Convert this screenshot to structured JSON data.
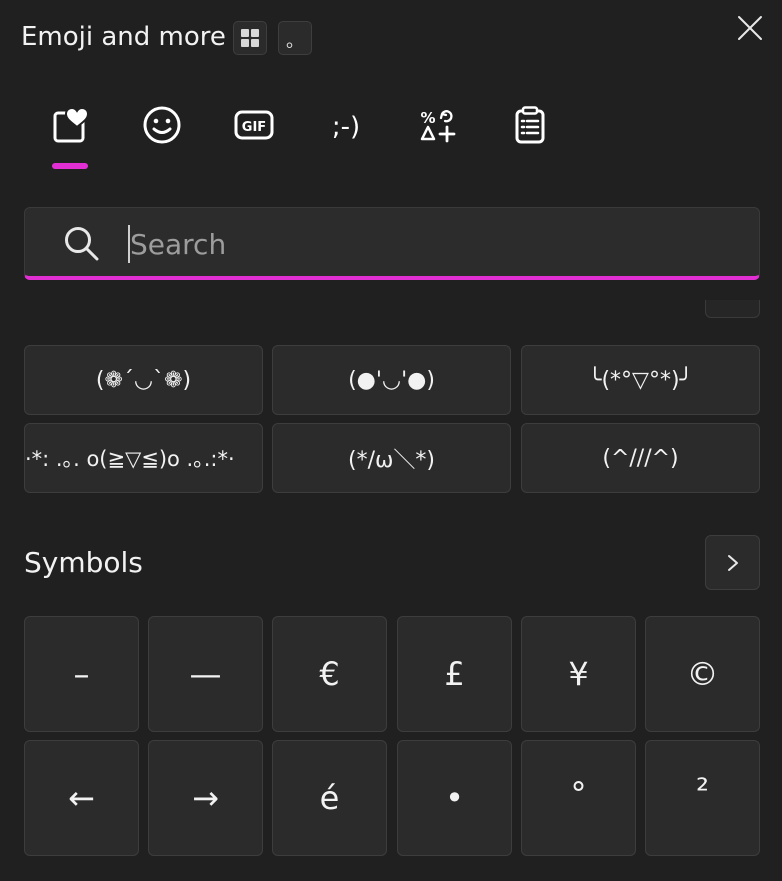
{
  "header": {
    "title": "Emoji and more",
    "dot_button_glyph": "。"
  },
  "tabs": [
    {
      "name": "favorites",
      "icon": "heart-frame-icon",
      "selected": true
    },
    {
      "name": "emoji",
      "icon": "smiley-icon",
      "selected": false
    },
    {
      "name": "gif",
      "icon": "gif-icon",
      "label": "GIF",
      "selected": false
    },
    {
      "name": "kaomoji",
      "icon": "kaomoji-icon",
      "label": ";-)",
      "selected": false
    },
    {
      "name": "symbols",
      "icon": "symbols-icon",
      "selected": false
    },
    {
      "name": "clipboard",
      "icon": "clipboard-icon",
      "selected": false
    }
  ],
  "search": {
    "placeholder": "Search",
    "value": ""
  },
  "kaomoji": [
    "(❁´◡`❁)",
    "(●'◡'●)",
    "╰(*°▽°*)╯",
    "·*: .｡. o(≧▽≦)o .｡.:*·",
    "(*/ω＼*)",
    "(^///^)"
  ],
  "symbols_section": {
    "title": "Symbols",
    "items": [
      "–",
      "—",
      "€",
      "£",
      "¥",
      "©",
      "←",
      "→",
      "é",
      "•",
      "°",
      "²"
    ]
  },
  "colors": {
    "accent": "#e12fd4",
    "background": "#202020",
    "tile": "#2b2b2b",
    "tile_border": "#3d3d3d"
  }
}
